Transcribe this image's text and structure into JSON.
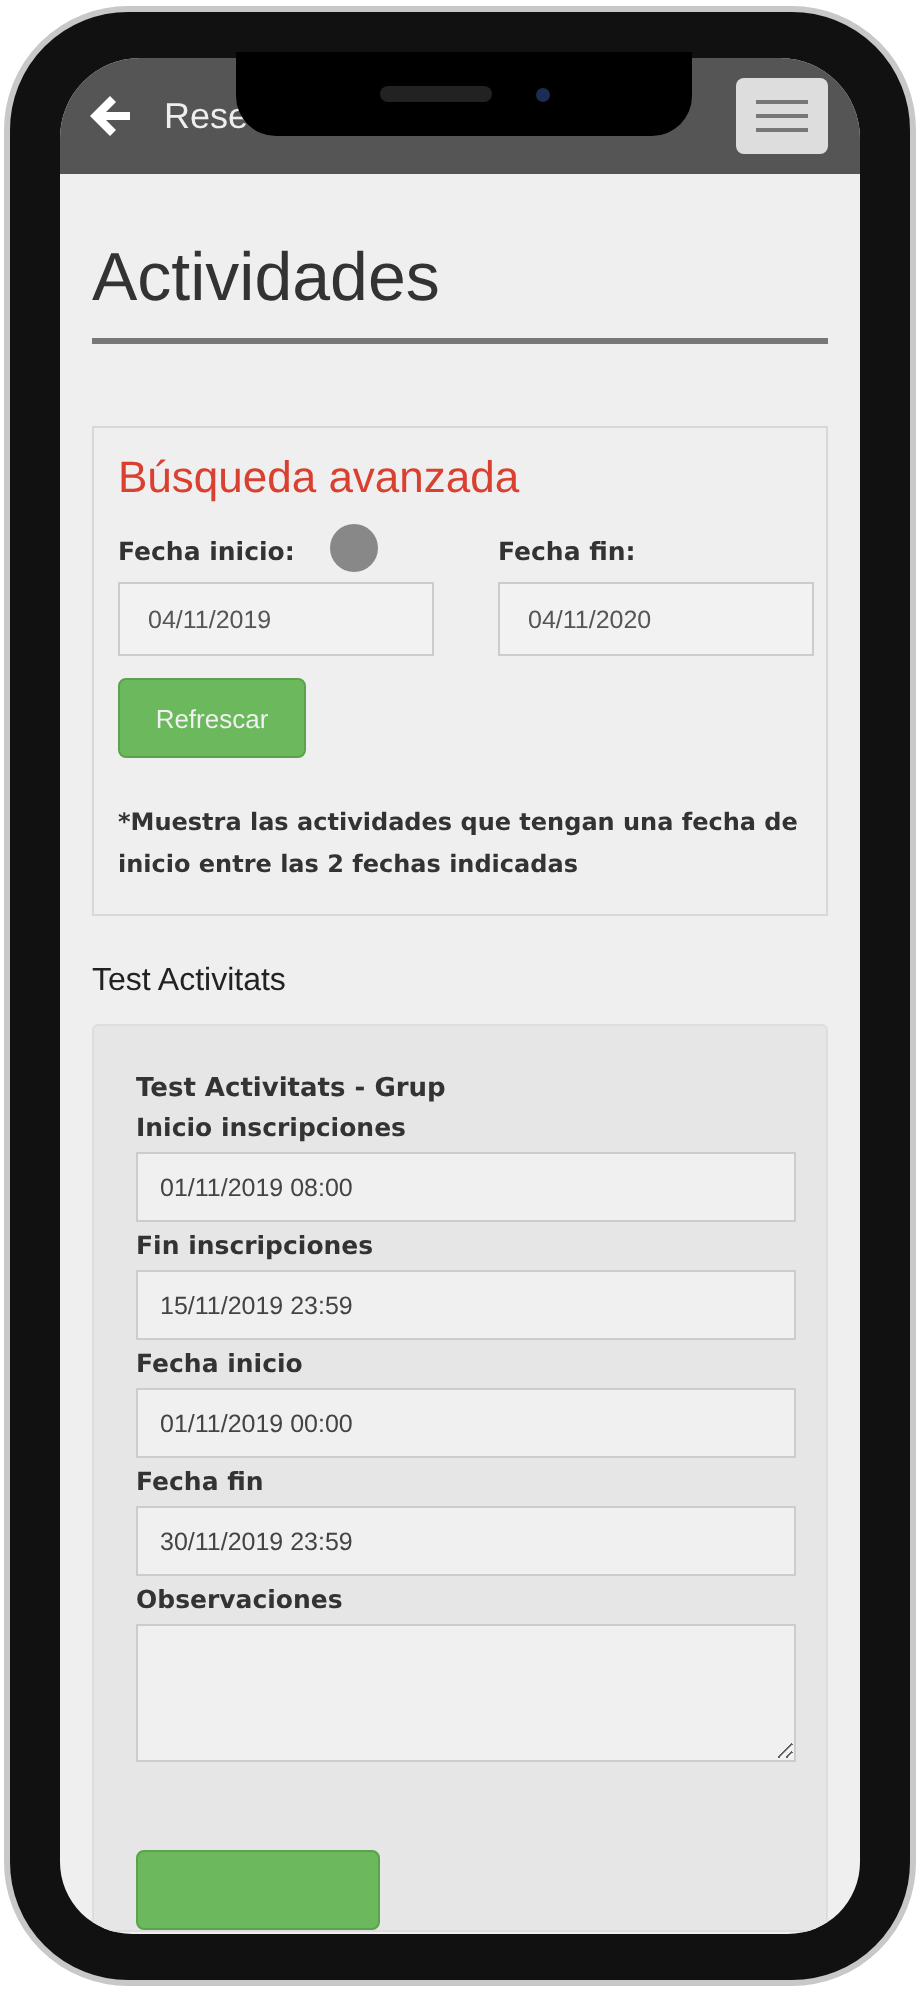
{
  "header": {
    "title": "Rese"
  },
  "page_title": "Actividades",
  "search": {
    "title": "Búsqueda avanzada",
    "fields": [
      {
        "label": "Fecha inicio:",
        "value": "04/11/2019"
      },
      {
        "label": "Fecha fin:",
        "value": "04/11/2020"
      }
    ],
    "button": "Refrescar",
    "note": "*Muestra las actividades que tengan una fecha de inicio entre las 2 fechas indicadas"
  },
  "section_title": "Test Activitats",
  "group": {
    "title": "Test Activitats - Grup",
    "fields": [
      {
        "kind": "input",
        "label": "Inicio inscripciones",
        "value": "01/11/2019 08:00"
      },
      {
        "kind": "input",
        "label": "Fin inscripciones",
        "value": "15/11/2019 23:59"
      },
      {
        "kind": "input",
        "label": "Fecha inicio",
        "value": "01/11/2019 00:00"
      },
      {
        "kind": "input",
        "label": "Fecha fin",
        "value": "30/11/2019 23:59"
      },
      {
        "kind": "textarea",
        "label": "Observaciones"
      }
    ]
  }
}
